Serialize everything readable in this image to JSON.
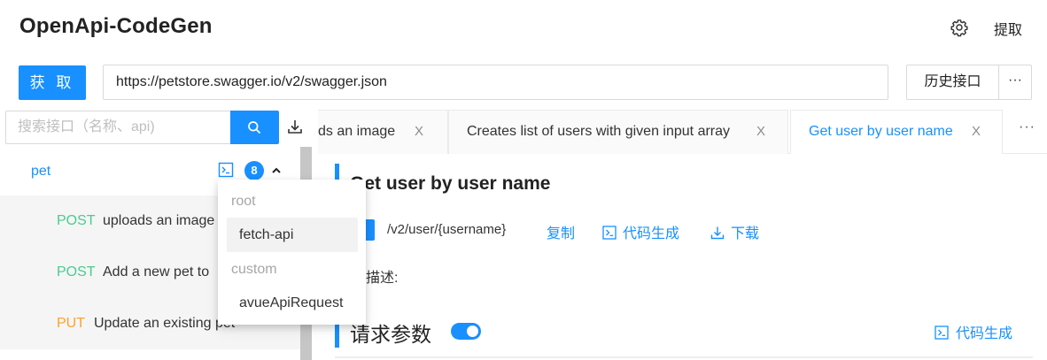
{
  "app": {
    "title": "OpenApi-CodeGen",
    "extract_label": "提取"
  },
  "fetch": {
    "button_label": "获 取",
    "url_value": "https://petstore.swagger.io/v2/swagger.json",
    "history_label": "历史接口",
    "more_label": "···"
  },
  "sidebar": {
    "search_placeholder": "搜索接口（名称、api)",
    "group": {
      "name": "pet",
      "count": "8"
    },
    "items": [
      {
        "method": "POST",
        "name": "uploads an image"
      },
      {
        "method": "POST",
        "name": "Add a new pet to"
      },
      {
        "method": "PUT",
        "name": "Update an existing pet"
      }
    ]
  },
  "dropdown": {
    "groups": [
      {
        "label": "root",
        "items": [
          "fetch-api"
        ]
      },
      {
        "label": "custom",
        "items": [
          "avueApiRequest"
        ]
      }
    ]
  },
  "tabs": {
    "items": [
      {
        "label": "ds an image",
        "active": false
      },
      {
        "label": "Creates list of users with given input array",
        "active": false
      },
      {
        "label": "Get user by user name",
        "active": true
      }
    ],
    "close_glyph": "X",
    "more_label": "···"
  },
  "detail": {
    "title": "Get user by user name",
    "path": "/v2/user/{username}",
    "copy_label": "复制",
    "codegen_label": "代码生成",
    "download_label": "下载",
    "description_label": "描述:",
    "params_title": "请求参数",
    "params_toggle_on": true,
    "params_codegen_label": "代码生成"
  },
  "colors": {
    "primary": "#1890ff",
    "post": "#49cc90",
    "put": "#fca130"
  }
}
